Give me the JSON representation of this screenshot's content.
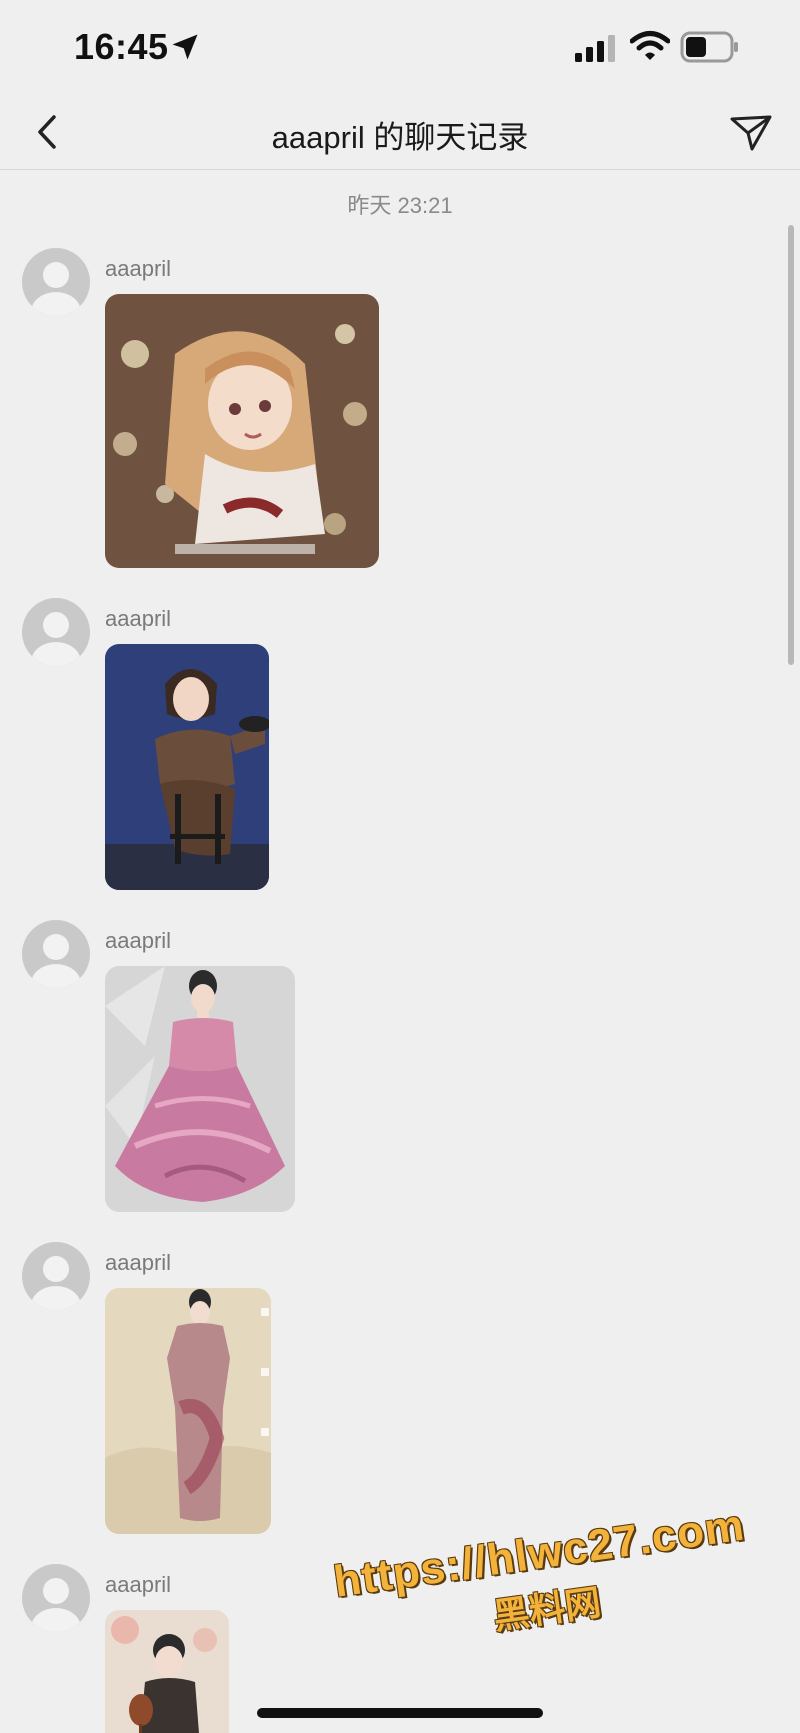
{
  "status_bar": {
    "time": "16:45",
    "icons": [
      "location-arrow-icon",
      "cellular-signal-icon",
      "wifi-icon",
      "battery-icon"
    ]
  },
  "nav": {
    "title": "aaapril 的聊天记录",
    "back_icon": "chevron-left-icon",
    "send_icon": "send-icon"
  },
  "chat": {
    "timestamp": "昨天 23:21",
    "messages": [
      {
        "sender": "aaapril",
        "type": "image",
        "subject": "anime girl with long hair and flowers"
      },
      {
        "sender": "aaapril",
        "type": "image",
        "subject": "illustrated woman in dark dress on bar stool"
      },
      {
        "sender": "aaapril",
        "type": "image",
        "subject": "illustrated woman in pink ruffled gown"
      },
      {
        "sender": "aaapril",
        "type": "image",
        "subject": "illustrated woman in qipao dress"
      },
      {
        "sender": "aaapril",
        "type": "image",
        "subject": "illustrated woman holding fan"
      }
    ]
  },
  "watermark": {
    "url": "https://hlwc27.com",
    "subtitle": "黑料网"
  },
  "colors": {
    "background": "#efefef",
    "text_primary": "#1a1a1a",
    "text_secondary": "#7a7a7a",
    "watermark": "#f3b23a"
  }
}
